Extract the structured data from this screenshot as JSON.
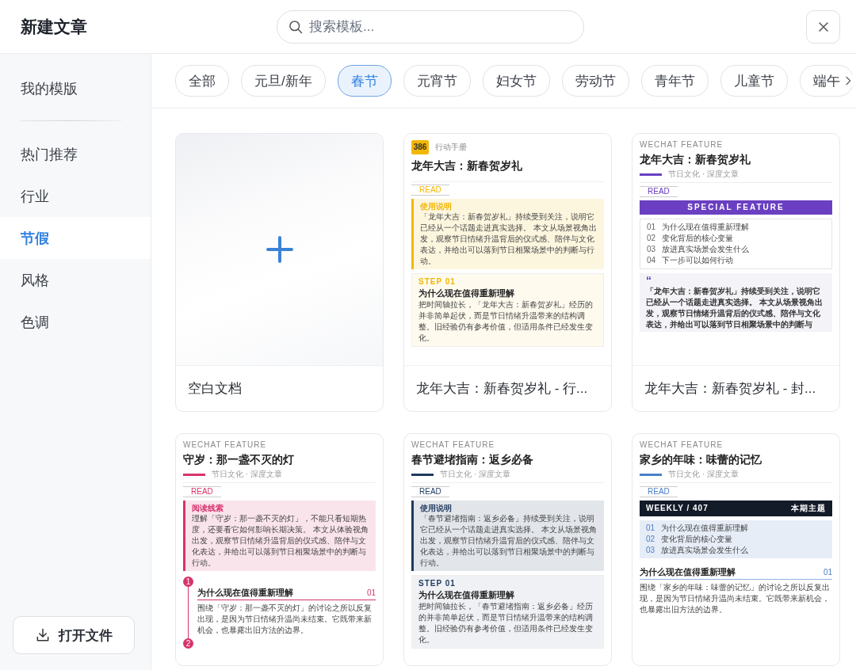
{
  "header": {
    "title": "新建文章",
    "search": {
      "placeholder": "搜索模板..."
    }
  },
  "sidebar": {
    "items": [
      {
        "label": "我的模版",
        "selected": false
      },
      {
        "label": "热门推荐",
        "selected": false
      },
      {
        "label": "行业",
        "selected": false
      },
      {
        "label": "节假",
        "selected": true
      },
      {
        "label": "风格",
        "selected": false
      },
      {
        "label": "色调",
        "selected": false
      }
    ],
    "open_button": "打开文件"
  },
  "categories": [
    {
      "label": "全部",
      "selected": false
    },
    {
      "label": "元旦/新年",
      "selected": false
    },
    {
      "label": "春节",
      "selected": true
    },
    {
      "label": "元宵节",
      "selected": false
    },
    {
      "label": "妇女节",
      "selected": false
    },
    {
      "label": "劳动节",
      "selected": false
    },
    {
      "label": "青年节",
      "selected": false
    },
    {
      "label": "儿童节",
      "selected": false
    },
    {
      "label": "端午",
      "selected": false
    }
  ],
  "templates": [
    {
      "kind": "blank",
      "name": "空白文档"
    },
    {
      "kind": "document",
      "name": "龙年大吉：新春贺岁礼 - 行...",
      "color": "#f2b705",
      "blocks": [
        {
          "kind": "badge_header",
          "badge": "386",
          "label": "行动手册"
        },
        {
          "kind": "title",
          "text": "龙年大吉：新春贺岁礼"
        },
        {
          "kind": "read",
          "text": "READ"
        },
        {
          "kind": "callout",
          "label": "使用说明",
          "text": "「龙年大吉：新春贺岁礼」持续受到关注，说明它已经从一个话题走进真实选择。 本文从场景视角出发，观察节日情绪升温背后的仪式感、陪伴与文化表达，并给出可以落到节日相聚场景中的判断与行动。"
        },
        {
          "kind": "step",
          "label": "STEP 01",
          "heading": "为什么现在值得重新理解",
          "text": "把时间轴拉长，「龙年大吉：新春贺岁礼」经历的并非简单起伏，而是节日情绪升温带来的结构调整。旧经验仍有参考价值，但适用条件已经发生变化。"
        }
      ]
    },
    {
      "kind": "document",
      "name": "龙年大吉：新春贺岁礼 - 封...",
      "color": "#6a3fc1",
      "blocks": [
        {
          "kind": "eyebrow",
          "text": "WECHAT FEATURE"
        },
        {
          "kind": "title",
          "text": "龙年大吉：新春贺岁礼"
        },
        {
          "kind": "meta",
          "text": "节日文化 · 深度文章"
        },
        {
          "kind": "read",
          "text": "READ"
        },
        {
          "kind": "banner",
          "text": "SPECIAL FEATURE"
        },
        {
          "kind": "toc",
          "items": [
            {
              "number": "01",
              "text": "为什么现在值得重新理解"
            },
            {
              "number": "02",
              "text": "变化背后的核心变量"
            },
            {
              "number": "03",
              "text": "放进真实场景会发生什么"
            },
            {
              "number": "04",
              "text": "下一步可以如何行动"
            }
          ]
        },
        {
          "kind": "quote",
          "mark": "“",
          "text": "「龙年大吉：新春贺岁礼」持续受到关注，说明它已经从一个话题走进真实选择。 本文从场景视角出发，观察节日情绪升温背后的仪式感、陪伴与文化表达，并给出可以落到节日相聚场景中的判断与"
        }
      ]
    },
    {
      "kind": "document",
      "color": "#d6336c",
      "blocks": [
        {
          "kind": "eyebrow",
          "text": "WECHAT FEATURE"
        },
        {
          "kind": "title",
          "text": "守岁：那一盏不灭的灯"
        },
        {
          "kind": "meta",
          "text": "节日文化 · 深度文章"
        },
        {
          "kind": "read",
          "text": "READ"
        },
        {
          "kind": "callout",
          "label": "阅读线索",
          "text": "理解「守岁：那一盏不灭的灯」，不能只看短期热度，还要看它如何影响长期决策。 本文从体验视角出发，观察节日情绪升温背后的仪式感、陪伴与文化表达，并给出可以落到节日相聚场景中的判断与行动。"
        },
        {
          "kind": "timeline",
          "step": "1",
          "heading": "为什么现在值得重新理解",
          "number": "01",
          "text": "围绕「守岁：那一盏不灭的灯」的讨论之所以反复出现，是因为节日情绪升温尚未结束。它既带来新机会，也暴露出旧方法的边界。",
          "next": "2"
        }
      ]
    },
    {
      "kind": "document",
      "color": "#1e3a5f",
      "blocks": [
        {
          "kind": "eyebrow",
          "text": "WECHAT FEATURE"
        },
        {
          "kind": "title",
          "text": "春节避堵指南：返乡必备"
        },
        {
          "kind": "meta",
          "text": "节日文化 · 深度文章"
        },
        {
          "kind": "read",
          "text": "READ"
        },
        {
          "kind": "callout",
          "label": "使用说明",
          "text": "「春节避堵指南：返乡必备」持续受到关注，说明它已经从一个话题走进真实选择。 本文从场景视角出发，观察节日情绪升温背后的仪式感、陪伴与文化表达，并给出可以落到节日相聚场景中的判断与行动。"
        },
        {
          "kind": "step",
          "label": "STEP 01",
          "heading": "为什么现在值得重新理解",
          "text": "把时间轴拉长，「春节避堵指南：返乡必备」经历的并非简单起伏，而是节日情绪升温带来的结构调整。旧经验仍有参考价值，但适用条件已经发生变化。"
        }
      ]
    },
    {
      "kind": "document",
      "color": "#4a7fc8",
      "blocks": [
        {
          "kind": "eyebrow",
          "text": "WECHAT FEATURE"
        },
        {
          "kind": "title",
          "text": "家乡的年味：味蕾的记忆"
        },
        {
          "kind": "meta",
          "text": "节日文化 · 深度文章"
        },
        {
          "kind": "read",
          "text": "READ"
        },
        {
          "kind": "masthead",
          "left": "WEEKLY / 407",
          "right": "本期主题"
        },
        {
          "kind": "toc",
          "items": [
            {
              "number": "01",
              "text": "为什么现在值得重新理解"
            },
            {
              "number": "02",
              "text": "变化背后的核心变量"
            },
            {
              "number": "03",
              "text": "放进真实场景会发生什么"
            }
          ]
        },
        {
          "kind": "section",
          "heading": "为什么现在值得重新理解",
          "number": "01",
          "text": "围绕「家乡的年味：味蕾的记忆」的讨论之所以反复出现，是因为节日情绪升温尚未结束。它既带来新机会，也暴露出旧方法的边界。"
        }
      ]
    }
  ]
}
